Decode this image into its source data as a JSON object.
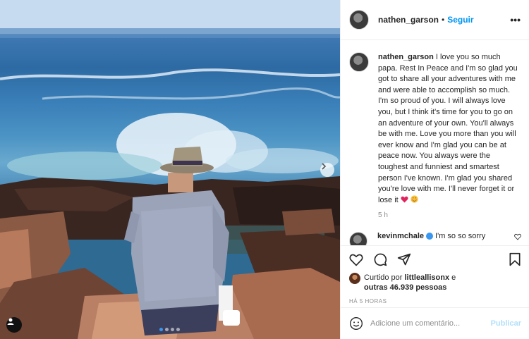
{
  "post": {
    "username": "nathen_garson",
    "follow_label": "Seguir",
    "separator": "•",
    "more_label": "•••",
    "caption_username": "nathen_garson",
    "caption": "I love you so much papa. Rest In Peace and I'm so glad you got to share all your adventures with me and were able to accomplish so much. I'm so proud of you. I will always love you, but I think it's time for you to go on an adventure of your own. You'll always be with me. Love you more than you will ever know and I'm glad you can be at peace now. You always were the toughest and funniest and smartest person I've known. I'm glad you shared you're love with me. I'll never forget it or lose it",
    "caption_emojis": [
      "heart",
      "blush-face"
    ],
    "caption_time": "5 h",
    "carousel": {
      "slide_count": 4,
      "active_slide": 1
    }
  },
  "comments": [
    {
      "username": "kevinmchale",
      "verified": true,
      "text": "I'm so so sorry"
    }
  ],
  "likes": {
    "prefix": "Curtido por",
    "user": "littleallisonx",
    "connector": "e",
    "others": "outras 46.939 pessoas"
  },
  "posted_ago": "HÁ 5 HORAS",
  "comment_box": {
    "placeholder": "Adicione um comentário...",
    "publish_label": "Publicar"
  },
  "icons": {
    "like": "heart-outline-icon",
    "comment": "comment-bubble-icon",
    "share": "paper-plane-icon",
    "save": "bookmark-icon",
    "emoji": "smiley-icon",
    "tag": "person-tag-icon",
    "next": "chevron-right-icon"
  },
  "colors": {
    "accent": "#0095f6",
    "verified": "#3897f0",
    "publish_disabled": "#b2dffc",
    "muted_text": "#8e8e8e"
  }
}
